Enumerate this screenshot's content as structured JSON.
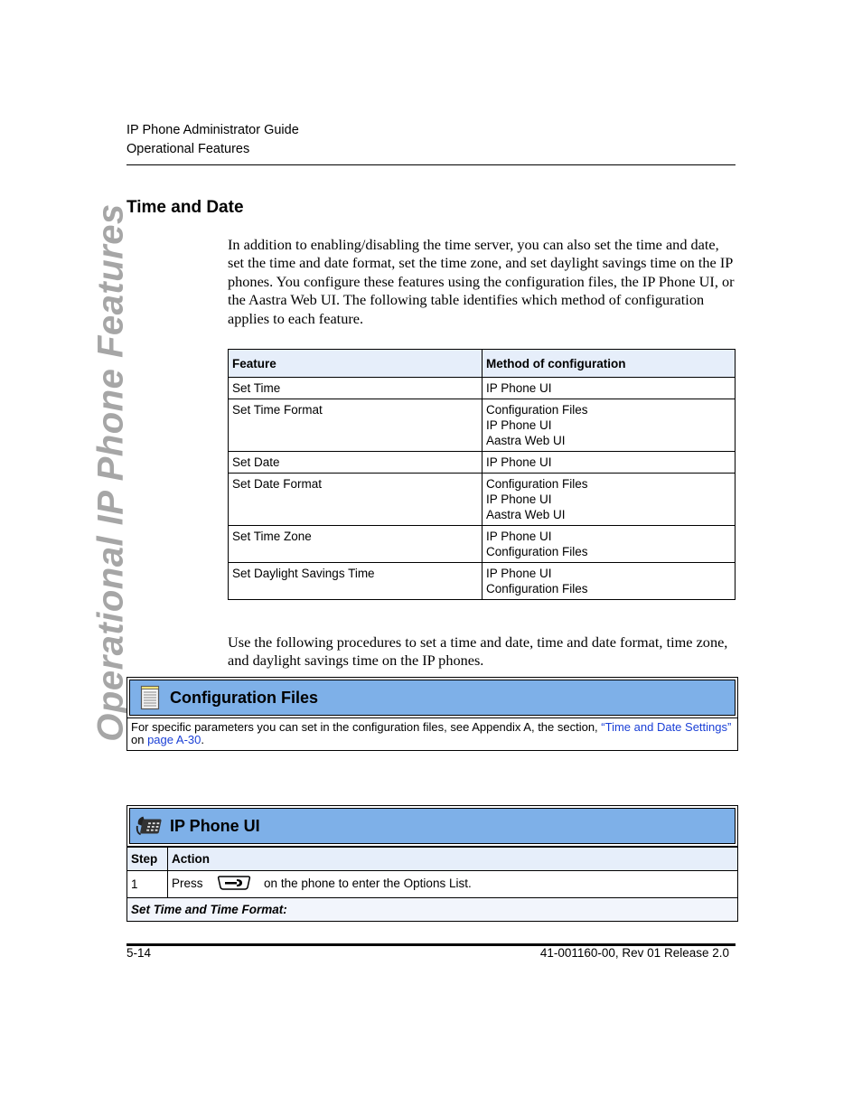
{
  "header": {
    "guide_title": "IP Phone Administrator Guide",
    "chapter": "Operational Features"
  },
  "side_tab": "Operational IP Phone Features",
  "section": {
    "title": "Time and Date",
    "intro": "In addition to enabling/disabling the time server, you can also set the time and date, set the time and date format, set the time zone, and set daylight savings time on the IP phones. You configure these features using the configuration files, the IP Phone UI, or the Aastra Web UI. The following table identifies which method of configuration applies to each feature.",
    "followup": "Use the following procedures to set a time and date, time and date format, time zone, and daylight savings time on the IP phones."
  },
  "feature_table": {
    "headers": [
      "Feature",
      "Method of configuration"
    ],
    "rows": [
      {
        "feature": "Set Time",
        "methods": [
          "IP Phone UI"
        ]
      },
      {
        "feature": "Set Time Format",
        "methods": [
          "Configuration Files",
          "IP Phone UI",
          "Aastra Web UI"
        ]
      },
      {
        "feature": "Set Date",
        "methods": [
          "IP Phone UI"
        ]
      },
      {
        "feature": "Set Date Format",
        "methods": [
          "Configuration Files",
          "IP Phone UI",
          "Aastra Web UI"
        ]
      },
      {
        "feature": "Set Time Zone",
        "methods": [
          "IP Phone UI",
          "Configuration Files"
        ]
      },
      {
        "feature": "Set Daylight Savings Time",
        "methods": [
          "IP Phone UI",
          "Configuration Files"
        ]
      }
    ]
  },
  "config_files_box": {
    "title": "Configuration Files",
    "icon": "notepad-icon",
    "text_before": "For specific parameters you can set in the configuration files, see Appendix A, the section, ",
    "link1": "“Time and Date Settings”",
    "text_mid": " on ",
    "link2": "page A-30",
    "text_after": "."
  },
  "ip_phone_box": {
    "title": "IP Phone UI",
    "icon": "desk-phone-icon",
    "headers": [
      "Step",
      "Action"
    ],
    "step1": {
      "number": "1",
      "before": "Press",
      "key_icon": "options-key-icon",
      "after": "on the phone to enter the Options List."
    },
    "subheading": "Set Time and Time Format:"
  },
  "footer": {
    "page_number": "5-14",
    "doc_id": "41-001160-00, Rev 01  Release 2.0"
  },
  "colors": {
    "banner": "#7eb0e8",
    "table_header": "#e6eefa",
    "link": "#1a3fd6",
    "side_tab": "#a6a6a6"
  }
}
